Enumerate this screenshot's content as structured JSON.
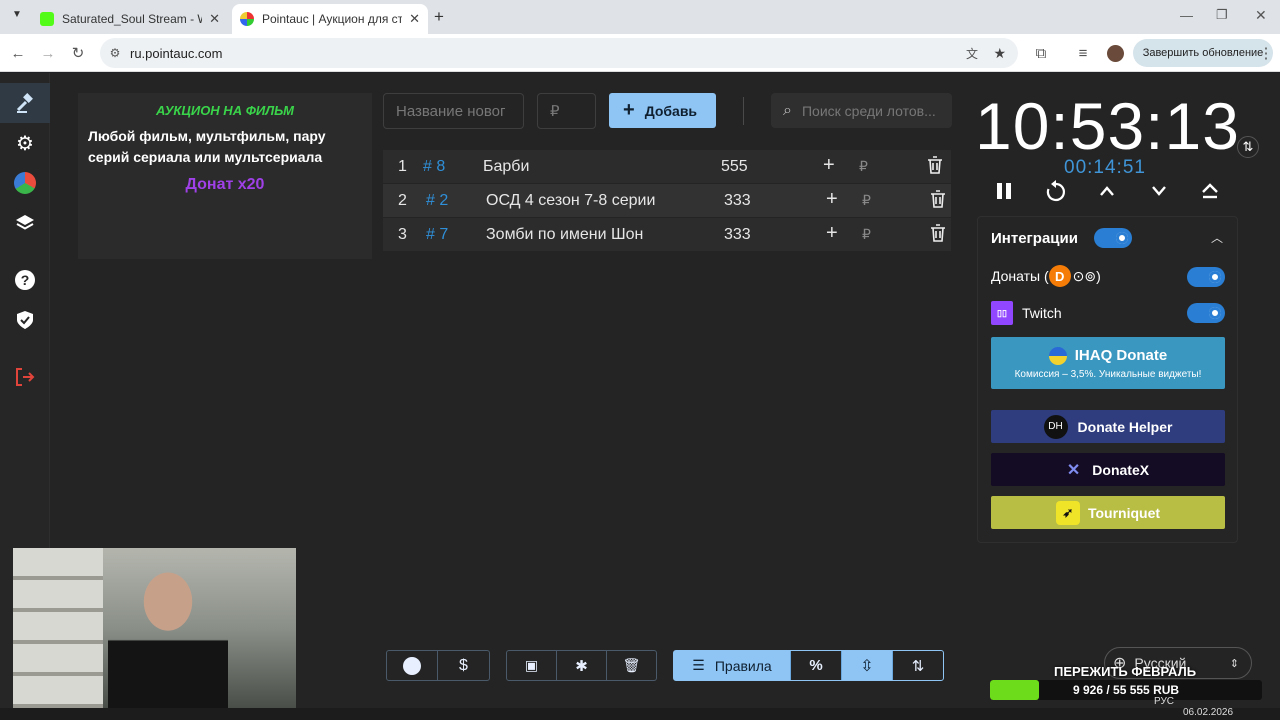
{
  "browser": {
    "tabs": [
      {
        "title": "Saturated_Soul Stream - Watch",
        "active": false
      },
      {
        "title": "Pointauc | Аукцион для стриме",
        "active": true
      }
    ],
    "url": "ru.pointauc.com",
    "update_label": "Завершить обновление"
  },
  "rules": {
    "title": "АУКЦИОН НА ФИЛЬМ",
    "body": "Любой фильм, мультфильм, пару серий сериала или мультсериала",
    "footer": "Донат x20"
  },
  "lot_form": {
    "name_placeholder": "Название новог",
    "amount_placeholder": "₽",
    "add_label": "Добавь",
    "search_placeholder": "Поиск среди лотов..."
  },
  "lots": [
    {
      "rank": "1",
      "id": "# 8",
      "name": "Барби",
      "amount": "555"
    },
    {
      "rank": "2",
      "id": "# 2",
      "name": "ОСД 4 сезон 7-8 серии",
      "amount": "333"
    },
    {
      "rank": "3",
      "id": "# 7",
      "name": "Зомби по имени Шон",
      "amount": "333"
    }
  ],
  "lot_currency": "₽",
  "timer": {
    "main": "10:53:13",
    "sub": "00:14:51"
  },
  "integrations": {
    "title": "Интеграции",
    "donations_label": "Донаты (",
    "donations_close": ")",
    "twitch_label": "Twitch",
    "services": {
      "ihaq_title": "IHAQ Donate",
      "ihaq_sub": "Комиссия – 3,5%. Уникальные виджеты!",
      "donate_helper": "Donate Helper",
      "donatex": "DonateX",
      "tourniquet": "Tourniquet"
    }
  },
  "bottom": {
    "rules_label": "Правила"
  },
  "overlay": {
    "goal_title": "ПЕРЕЖИТЬ ФЕВРАЛЬ",
    "goal_value": "9 926 / 55 555 RUB",
    "goal_progress": 0.179,
    "language": "Русский",
    "date": "06.02.2026",
    "tray_lang": "РУС"
  },
  "colors": {
    "accent": "#2f8fd8",
    "add_button": "#8ec5f5",
    "rules_green": "#3ad44a",
    "rules_purple": "#a040e8"
  }
}
